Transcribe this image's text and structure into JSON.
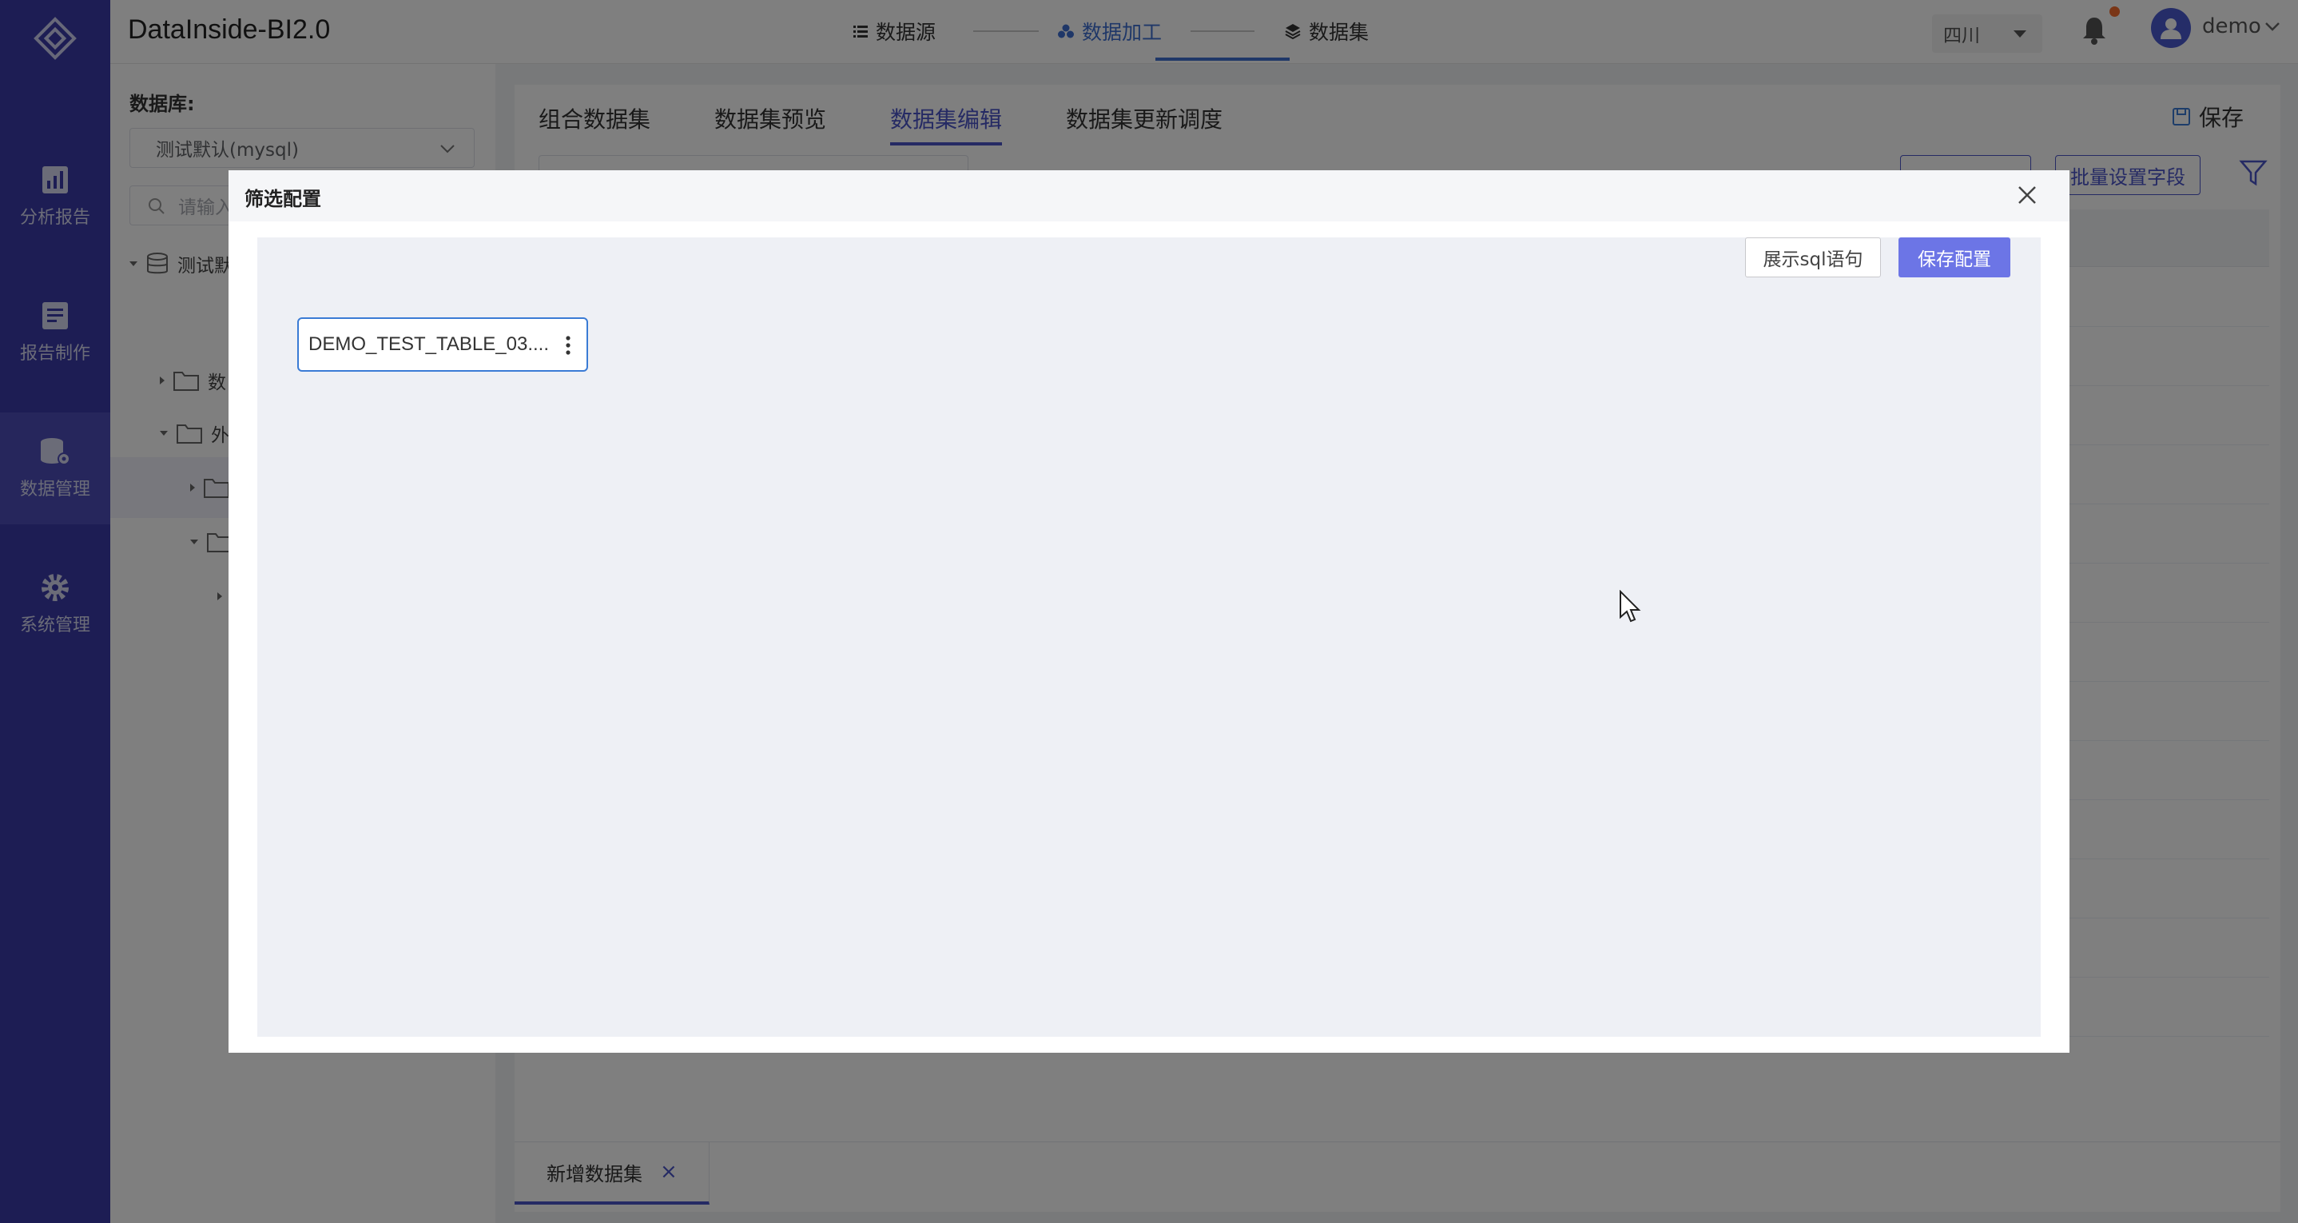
{
  "app": {
    "title": "DataInside-BI2.0"
  },
  "rail": {
    "items": [
      {
        "label": "分析报告",
        "icon": "analysis-report-icon"
      },
      {
        "label": "报告制作",
        "icon": "report-edit-icon"
      },
      {
        "label": "数据管理",
        "icon": "database-settings-icon",
        "active": true
      },
      {
        "label": "系统管理",
        "icon": "gear-icon"
      }
    ]
  },
  "steps": [
    {
      "label": "数据源",
      "icon": "list-icon"
    },
    {
      "label": "数据加工",
      "icon": "process-icon",
      "active": true
    },
    {
      "label": "数据集",
      "icon": "layers-icon"
    }
  ],
  "header": {
    "region": "四川",
    "user": "demo"
  },
  "left_panel": {
    "db_label": "数据库:",
    "db_value": "测试默认(mysql)",
    "search_placeholder": "请输入",
    "tree": [
      {
        "label": "测试默"
      },
      {
        "label": "数"
      },
      {
        "label": "外"
      }
    ]
  },
  "main": {
    "tabs": [
      "组合数据集",
      "数据集预览",
      "数据集编辑",
      "数据集更新调度"
    ],
    "active_tab": "数据集编辑",
    "save_label": "保存",
    "batch_label": "批量设置字段"
  },
  "bottom_tab": {
    "label": "新增数据集",
    "close": "×"
  },
  "dialog": {
    "title": "筛选配置",
    "show_sql": "展示sql语句",
    "save_config": "保存配置",
    "node_label": "DEMO_TEST_TABLE_03...."
  },
  "colors": {
    "rail_bg": "#3a3aa8",
    "accent": "#4a55c8",
    "primary_button": "#6c75e6",
    "node_border": "#3a7bd5"
  }
}
